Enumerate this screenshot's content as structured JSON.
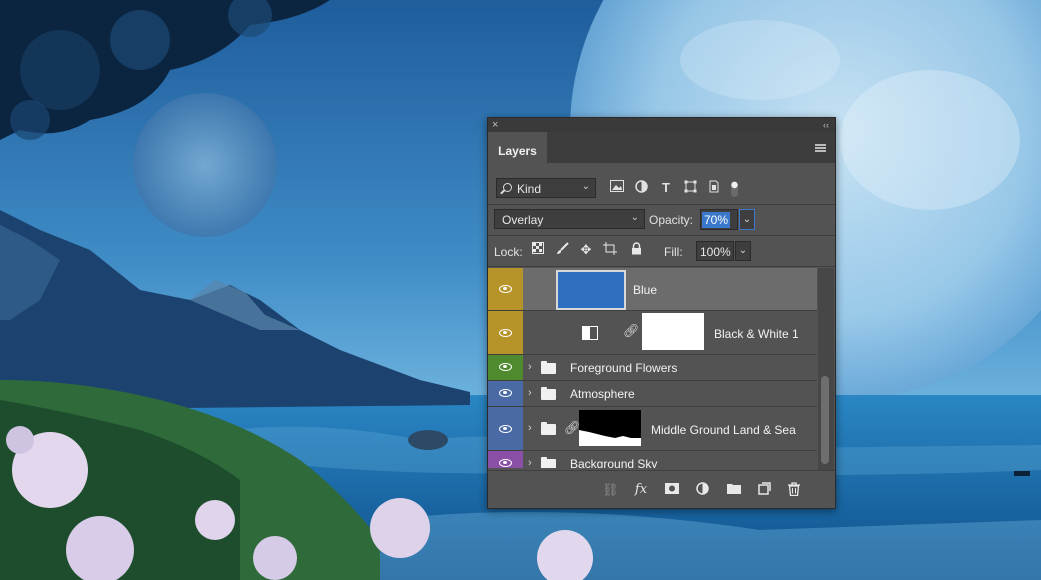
{
  "panel": {
    "tab_label": "Layers",
    "close_glyph": "×",
    "collapse_glyph": "‹‹",
    "menu_icon": "panel-menu-icon"
  },
  "filter": {
    "kind_label": "Kind",
    "icons": [
      "filter-pixel-icon",
      "filter-adjustment-icon",
      "filter-type-icon",
      "filter-shape-icon",
      "filter-smart-object-icon",
      "filter-toggle-icon"
    ]
  },
  "blend": {
    "mode": "Overlay",
    "opacity_label": "Opacity:",
    "opacity_value": "70%"
  },
  "lock": {
    "label": "Lock:",
    "icons": [
      "lock-transparent-icon",
      "lock-image-icon",
      "lock-position-icon",
      "lock-artboard-icon",
      "lock-all-icon"
    ],
    "fill_label": "Fill:",
    "fill_value": "100%"
  },
  "layers": [
    {
      "name": "Blue",
      "type": "fill",
      "label_color": "#b7942a",
      "selected": true,
      "thumb_color": "#2f6fbf"
    },
    {
      "name": "Black & White 1",
      "type": "adjustment",
      "label_color": "#b7942a",
      "selected": false
    },
    {
      "name": "Foreground Flowers",
      "type": "group",
      "label_color": "#4f8a2e",
      "selected": false
    },
    {
      "name": "Atmosphere",
      "type": "group",
      "label_color": "#4a6aa6",
      "selected": false
    },
    {
      "name": "Middle Ground Land & Sea",
      "type": "group-mask",
      "label_color": "#4a6aa6",
      "selected": false
    },
    {
      "name": "Background Sky",
      "type": "group",
      "label_color": "#8a4fa6",
      "selected": false
    }
  ],
  "bottom_icons": [
    "link-layers-icon",
    "fx-icon",
    "add-mask-icon",
    "adjustment-layer-icon",
    "new-group-icon",
    "new-layer-icon",
    "delete-icon"
  ],
  "colors": {
    "panel_bg": "#535353",
    "selection_blue": "#3a78c9"
  }
}
